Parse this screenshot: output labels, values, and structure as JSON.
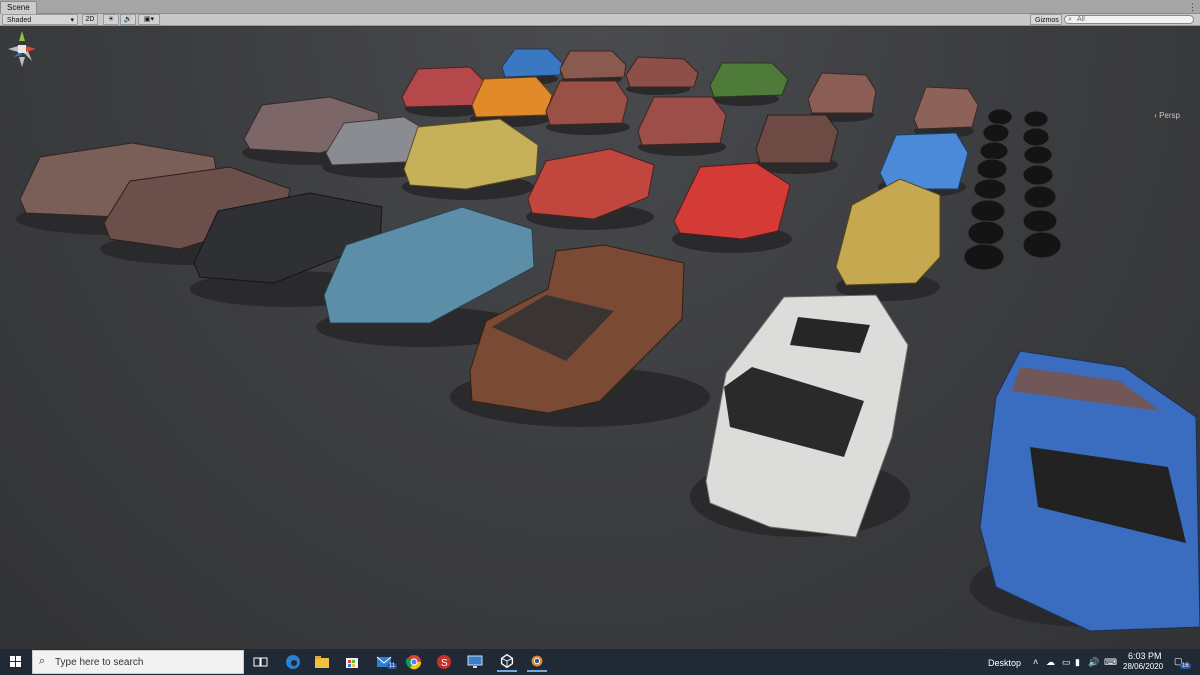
{
  "window": {
    "tab_label": "Scene",
    "tab_menu": "⋮"
  },
  "toolbar": {
    "shading_mode": "Shaded",
    "mode_2d": "2D",
    "lighting_icon": "sun-icon",
    "audio_icon": "speaker-icon",
    "effects_icon": "image-icon",
    "gizmos_label": "Gizmos",
    "search_placeholder": "All"
  },
  "viewport": {
    "projection_label": "Persp",
    "gizmo_axes": [
      "x",
      "y",
      "z"
    ]
  },
  "taskbar": {
    "search_placeholder": "Type here to search",
    "apps": [
      "task-view-icon",
      "edge-icon",
      "file-explorer-icon",
      "store-icon",
      "mail-icon",
      "chrome-icon",
      "app-s-icon",
      "remote-icon",
      "unity-icon",
      "blender-icon"
    ],
    "mail_badge": "11",
    "desktop_label": "Desktop",
    "time": "6:03 PM",
    "date": "28/06/2020",
    "notification_count": "16"
  },
  "colors": {
    "unity_toolbar": "#c8c8c8",
    "scene_background": "#3d3e41",
    "taskbar": "#1f2a36",
    "accent_blue": "#3a6cc0"
  }
}
